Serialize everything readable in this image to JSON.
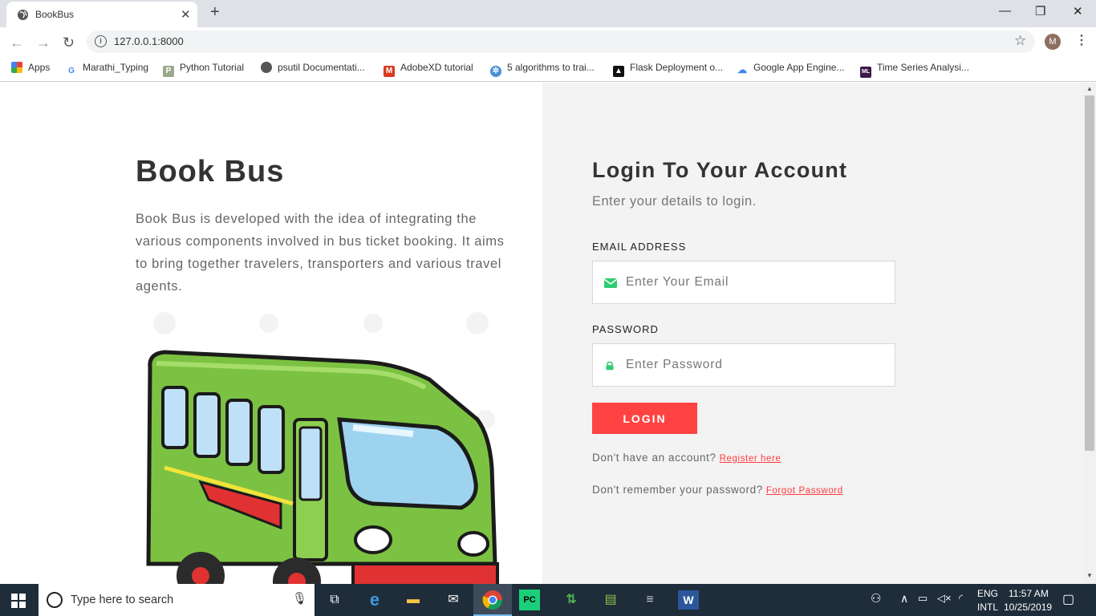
{
  "browser": {
    "tab_title": "BookBus",
    "tab_close": "✕",
    "new_tab": "+",
    "url": "127.0.0.1:8000",
    "profile_initial": "M",
    "bookmarks": [
      {
        "label": "Apps",
        "icon": "apps-grid-icon",
        "color": "#e44"
      },
      {
        "label": "Marathi_Typing",
        "icon": "google-icon",
        "color": "#4285f4"
      },
      {
        "label": "Python Tutorial",
        "icon": "python-icon",
        "color": "#777"
      },
      {
        "label": "psutil Documentati...",
        "icon": "globe-icon",
        "color": "#555"
      },
      {
        "label": "AdobeXD tutorial",
        "icon": "medium-icon",
        "color": "#d93a20"
      },
      {
        "label": "5 algorithms to trai...",
        "icon": "gear-icon",
        "color": "#4a90d9"
      },
      {
        "label": "Flask Deployment o...",
        "icon": "flask-icon",
        "color": "#111"
      },
      {
        "label": "Google App Engine...",
        "icon": "cloud-icon",
        "color": "#4285f4"
      },
      {
        "label": "Time Series Analysi...",
        "icon": "ml-icon",
        "color": "#3a1a4a"
      }
    ]
  },
  "left": {
    "title": "Book Bus",
    "description": "Book Bus is developed with the idea of integrating the various components involved in bus ticket booking. It aims to bring together travelers, transporters and various travel agents."
  },
  "login": {
    "title": "Login To Your Account",
    "subtitle": "Enter your details to login.",
    "email_label": "EMAIL ADDRESS",
    "email_placeholder": "Enter Your Email",
    "email_value": "",
    "password_label": "PASSWORD",
    "password_placeholder": "Enter Password",
    "password_value": "",
    "button": "LOGIN",
    "register_prompt": "Don't have an account?",
    "register_link": "Register here",
    "forgot_prompt": "Don't remember your password?",
    "forgot_link": "Forgot Password"
  },
  "taskbar": {
    "search_placeholder": "Type here to search",
    "lang_top": "ENG",
    "lang_bottom": "INTL",
    "time": "11:57 AM",
    "date": "10/25/2019"
  },
  "colors": {
    "accent": "#ff4343",
    "icon_green": "#2ecc71",
    "right_panel_bg": "#f3f3f3"
  }
}
